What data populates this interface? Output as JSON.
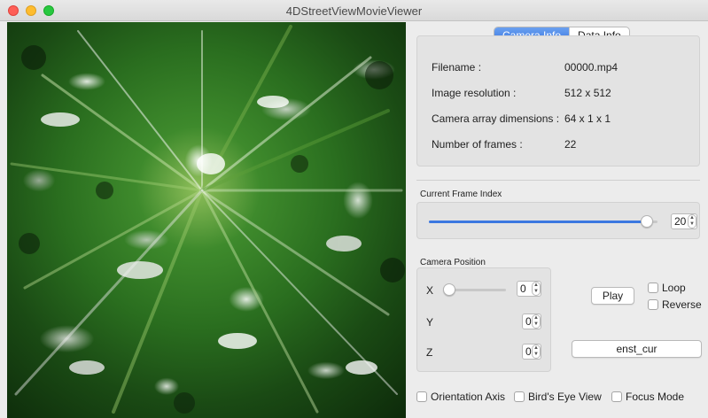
{
  "window": {
    "title": "4DStreetViewMovieViewer"
  },
  "tabs": {
    "camera_info": "Camera Info",
    "data_info": "Data Info"
  },
  "camera_info": {
    "rows": [
      {
        "label": "Filename :",
        "value": "00000.mp4"
      },
      {
        "label": "Image resolution :",
        "value": "512 x 512"
      },
      {
        "label": "Camera array dimensions :",
        "value": "64 x 1 x 1"
      },
      {
        "label": "Number of frames :",
        "value": "22"
      }
    ]
  },
  "frame_index": {
    "label": "Current Frame Index",
    "value": "20",
    "max": "21"
  },
  "camera_position": {
    "label": "Camera Position",
    "x_label": "X",
    "x_value": "0",
    "y_label": "Y",
    "y_value": "0",
    "z_label": "Z",
    "z_value": "0"
  },
  "playback": {
    "play_label": "Play",
    "loop_label": "Loop",
    "reverse_label": "Reverse"
  },
  "text_field": {
    "value": "enst_cur"
  },
  "options": {
    "orientation_axis": "Orientation Axis",
    "birds_eye_view": "Bird's Eye View",
    "focus_mode": "Focus Mode"
  },
  "colors": {
    "accent": "#3b78e0",
    "close": "#fe5f57",
    "minimize": "#febc2e",
    "maximize": "#28c840"
  }
}
